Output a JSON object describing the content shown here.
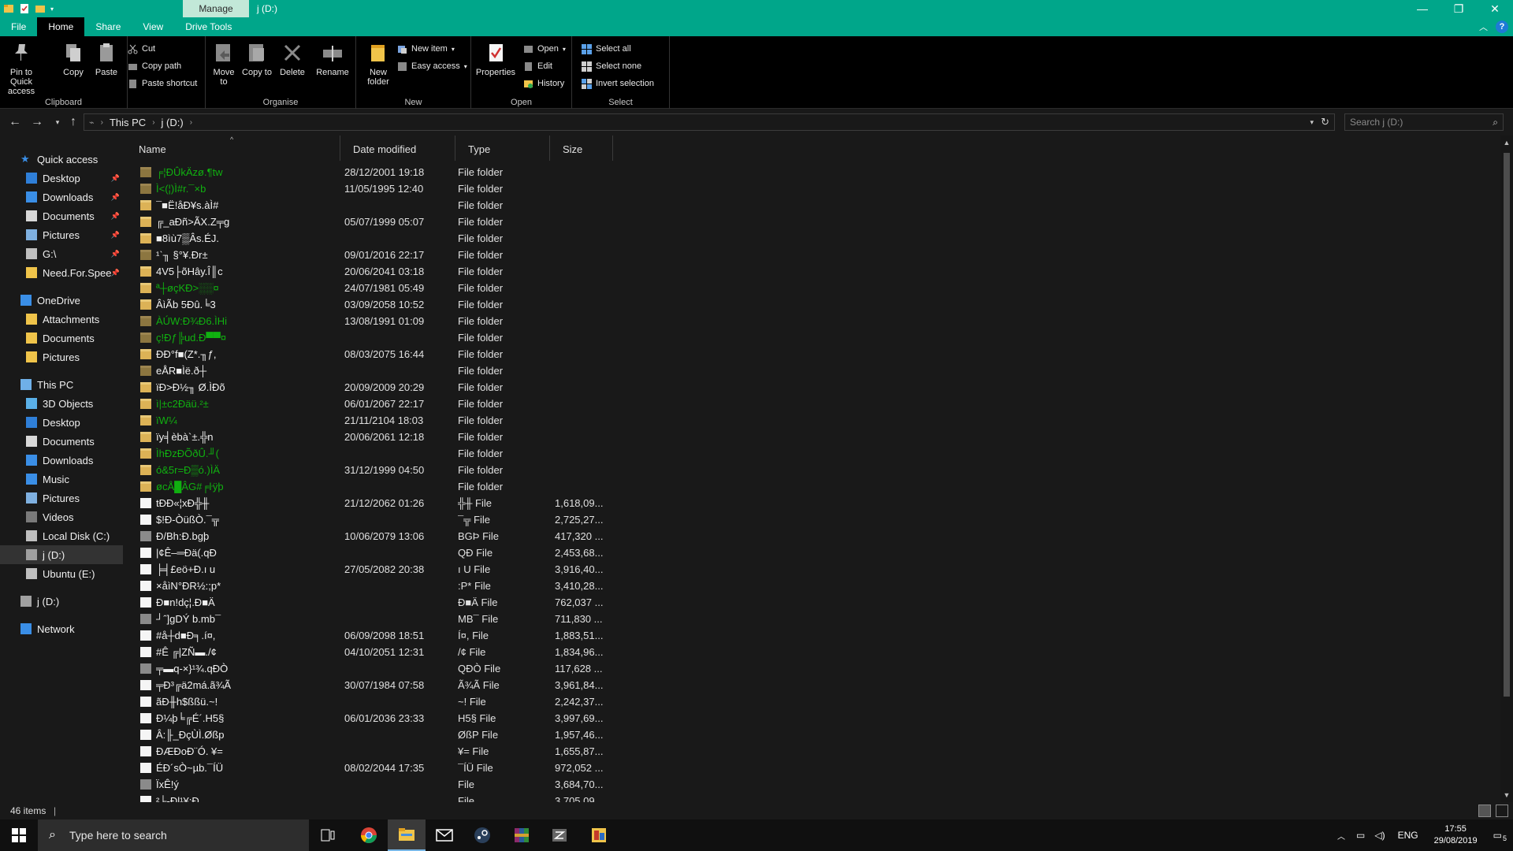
{
  "titlebar": {
    "context_tab": "Manage",
    "title": "j (D:)",
    "controls": [
      "—",
      "❐",
      "✕"
    ]
  },
  "tabs": [
    {
      "label": "File"
    },
    {
      "label": "Home"
    },
    {
      "label": "Share"
    },
    {
      "label": "View"
    },
    {
      "label": "Drive Tools"
    }
  ],
  "ribbon": {
    "clipboard": {
      "pin": "Pin to Quick access",
      "copy": "Copy",
      "paste": "Paste",
      "cut": "Cut",
      "copy_path": "Copy path",
      "paste_shortcut": "Paste shortcut",
      "label": "Clipboard"
    },
    "organise": {
      "move_to": "Move to",
      "copy_to": "Copy to",
      "delete": "Delete",
      "rename": "Rename",
      "label": "Organise"
    },
    "new": {
      "new_folder": "New folder",
      "new_item": "New item",
      "easy_access": "Easy access",
      "label": "New"
    },
    "open": {
      "properties": "Properties",
      "open": "Open",
      "edit": "Edit",
      "history": "History",
      "label": "Open"
    },
    "select": {
      "select_all": "Select all",
      "select_none": "Select none",
      "invert": "Invert selection",
      "label": "Select"
    }
  },
  "address": {
    "crumbs": [
      "This PC",
      "j (D:)"
    ],
    "search_placeholder": "Search j (D:)"
  },
  "nav": [
    {
      "label": "Quick access",
      "icon": "star-icon",
      "level": 0,
      "pinned": false
    },
    {
      "label": "Desktop",
      "icon": "desktop-icon",
      "level": 1,
      "pinned": true
    },
    {
      "label": "Downloads",
      "icon": "download-icon",
      "level": 1,
      "pinned": true
    },
    {
      "label": "Documents",
      "icon": "documents-icon",
      "level": 1,
      "pinned": true
    },
    {
      "label": "Pictures",
      "icon": "pictures-icon",
      "level": 1,
      "pinned": true
    },
    {
      "label": "G:\\",
      "icon": "network-drive-icon",
      "level": 1,
      "pinned": true
    },
    {
      "label": "Need.For.Spee",
      "icon": "folder-icon",
      "level": 1,
      "pinned": true
    },
    {
      "label": "OneDrive",
      "icon": "cloud-icon",
      "level": 0,
      "pinned": false
    },
    {
      "label": "Attachments",
      "icon": "folder-icon",
      "level": 1,
      "pinned": false
    },
    {
      "label": "Documents",
      "icon": "folder-icon",
      "level": 1,
      "pinned": false
    },
    {
      "label": "Pictures",
      "icon": "folder-icon",
      "level": 1,
      "pinned": false
    },
    {
      "label": "This PC",
      "icon": "pc-icon",
      "level": 0,
      "pinned": false
    },
    {
      "label": "3D Objects",
      "icon": "3d-objects-icon",
      "level": 1,
      "pinned": false
    },
    {
      "label": "Desktop",
      "icon": "desktop-icon",
      "level": 1,
      "pinned": false
    },
    {
      "label": "Documents",
      "icon": "documents-icon",
      "level": 1,
      "pinned": false
    },
    {
      "label": "Downloads",
      "icon": "download-icon",
      "level": 1,
      "pinned": false
    },
    {
      "label": "Music",
      "icon": "music-icon",
      "level": 1,
      "pinned": false
    },
    {
      "label": "Pictures",
      "icon": "pictures-icon",
      "level": 1,
      "pinned": false
    },
    {
      "label": "Videos",
      "icon": "videos-icon",
      "level": 1,
      "pinned": false
    },
    {
      "label": "Local Disk (C:)",
      "icon": "disk-icon",
      "level": 1,
      "pinned": false
    },
    {
      "label": "j (D:)",
      "icon": "usb-drive-icon",
      "level": 1,
      "pinned": false,
      "selected": true
    },
    {
      "label": "Ubuntu (E:)",
      "icon": "disk-icon",
      "level": 1,
      "pinned": false
    },
    {
      "label": "j (D:)",
      "icon": "usb-drive-icon",
      "level": 0,
      "pinned": false
    },
    {
      "label": "Network",
      "icon": "network-icon",
      "level": 0,
      "pinned": false
    }
  ],
  "columns": {
    "name": "Name",
    "date": "Date modified",
    "type": "Type",
    "size": "Size"
  },
  "files": [
    {
      "name": "╒¦ÐÛkÄzø.¶tw",
      "date": "28/12/2001 19:18",
      "type": "File folder",
      "size": "",
      "kind": "folder",
      "color": "green",
      "hidden": true
    },
    {
      "name": "Ì<(¦)Ì#r.¯×b",
      "date": "11/05/1995 12:40",
      "type": "File folder",
      "size": "",
      "kind": "folder",
      "color": "green",
      "hidden": true
    },
    {
      "name": "¯■Ë!åÐ¥s.àÌ#",
      "date": "",
      "type": "File folder",
      "size": "",
      "kind": "folder",
      "color": "white",
      "hidden": false
    },
    {
      "name": "╔_aÐñ>ÃX.Z╤g",
      "date": "05/07/1999 05:07",
      "type": "File folder",
      "size": "",
      "kind": "folder",
      "color": "white",
      "hidden": false
    },
    {
      "name": "■8ìù7▒Âs.ÉJ.",
      "date": "",
      "type": "File folder",
      "size": "",
      "kind": "folder",
      "color": "white",
      "hidden": false
    },
    {
      "name": "¹ˋ╖ §°¥.Ðr±",
      "date": "09/01/2016 22:17",
      "type": "File folder",
      "size": "",
      "kind": "folder",
      "color": "white",
      "hidden": true
    },
    {
      "name": "4V5├õHây.Î║c",
      "date": "20/06/2041 03:18",
      "type": "File folder",
      "size": "",
      "kind": "folder",
      "color": "white",
      "hidden": false
    },
    {
      "name": "ª┼øçKÐ>░░¤",
      "date": "24/07/1981 05:49",
      "type": "File folder",
      "size": "",
      "kind": "folder",
      "color": "green",
      "hidden": false
    },
    {
      "name": "ÂìÃb 5Ðû.╘3",
      "date": "03/09/2058 10:52",
      "type": "File folder",
      "size": "",
      "kind": "folder",
      "color": "white",
      "hidden": false
    },
    {
      "name": "ÀÚW:Ð¾Ð6.ÌHi",
      "date": "13/08/1991 01:09",
      "type": "File folder",
      "size": "",
      "kind": "folder",
      "color": "green",
      "hidden": true
    },
    {
      "name": "ç!Ðƒ╠ud.Ð▀▀¤",
      "date": "",
      "type": "File folder",
      "size": "",
      "kind": "folder",
      "color": "green",
      "hidden": true
    },
    {
      "name": "ÐÐ°f■(Z*.╖ƒ,",
      "date": "08/03/2075 16:44",
      "type": "File folder",
      "size": "",
      "kind": "folder",
      "color": "white",
      "hidden": false
    },
    {
      "name": "eÅR■Ìë.ð┼",
      "date": "",
      "type": "File folder",
      "size": "",
      "kind": "folder",
      "color": "white",
      "hidden": true
    },
    {
      "name": "ïÐ>Ð½╖ Ø.ÌÐõ",
      "date": "20/09/2009 20:29",
      "type": "File folder",
      "size": "",
      "kind": "folder",
      "color": "white",
      "hidden": false
    },
    {
      "name": "ì|±c2Ðäü.²±",
      "date": "06/01/2067 22:17",
      "type": "File folder",
      "size": "",
      "kind": "folder",
      "color": "green",
      "hidden": false
    },
    {
      "name": "ïW¼",
      "date": "21/11/2104 18:03",
      "type": "File folder",
      "size": "",
      "kind": "folder",
      "color": "green",
      "hidden": false
    },
    {
      "name": "ïy╡èbà`±.╬n",
      "date": "20/06/2061 12:18",
      "type": "File folder",
      "size": "",
      "kind": "folder",
      "color": "white",
      "hidden": false
    },
    {
      "name": "ÌhÐzÐÕðÛ.╜(",
      "date": "",
      "type": "File folder",
      "size": "",
      "kind": "folder",
      "color": "green",
      "hidden": false
    },
    {
      "name": "ó&5r=Ð▒ó.)ÌÄ",
      "date": "31/12/1999 04:50",
      "type": "File folder",
      "size": "",
      "kind": "folder",
      "color": "green",
      "hidden": false
    },
    {
      "name": "øcÅ█ÂG#╒ŀÿþ",
      "date": "",
      "type": "File folder",
      "size": "",
      "kind": "folder",
      "color": "green",
      "hidden": false
    },
    {
      "name": "tÐÐ«¦xÐ╬╫",
      "date": "21/12/2062 01:26",
      "type": "╬╫ File",
      "size": "1,618,09...",
      "kind": "file",
      "color": "white",
      "hidden": false
    },
    {
      "name": "$!Ð-ÒüßÒ.¯╦",
      "date": "",
      "type": "¯╦ File",
      "size": "2,725,27...",
      "kind": "file",
      "color": "white",
      "hidden": false
    },
    {
      "name": "Ð/Bh:Ð.bgþ",
      "date": "10/06/2079 13:06",
      "type": "BGÞ File",
      "size": "417,320 ...",
      "kind": "file",
      "color": "white",
      "hidden": true
    },
    {
      "name": "|¢Ê–═Ðä(.qÐ",
      "date": "",
      "type": "QÐ File",
      "size": "2,453,68...",
      "kind": "file",
      "color": "white",
      "hidden": false
    },
    {
      "name": "╞╡£eö+Ð.ı u",
      "date": "27/05/2082 20:38",
      "type": "ı U File",
      "size": "3,916,40...",
      "kind": "file",
      "color": "white",
      "hidden": false
    },
    {
      "name": "×åìN°ÐR½:;p*",
      "date": "",
      "type": ":P* File",
      "size": "3,410,28...",
      "kind": "file",
      "color": "white",
      "hidden": false
    },
    {
      "name": "Ð■n!dç¦.Ð■Ä",
      "date": "",
      "type": "Ð■Ä File",
      "size": "762,037 ...",
      "kind": "file",
      "color": "white",
      "hidden": false
    },
    {
      "name": "┘ˆ]gDÝ b.mb¯",
      "date": "",
      "type": "MB¯ File",
      "size": "711,830 ...",
      "kind": "file",
      "color": "white",
      "hidden": true
    },
    {
      "name": "#å┼d■Ð╕.í¤,",
      "date": "06/09/2098 18:51",
      "type": "Í¤, File",
      "size": "1,883,51...",
      "kind": "file",
      "color": "white",
      "hidden": false
    },
    {
      "name": "#Ê ╔|ZÑ▬./¢",
      "date": "04/10/2051 12:31",
      "type": "/¢ File",
      "size": "1,834,96...",
      "kind": "file",
      "color": "white",
      "hidden": false
    },
    {
      "name": "╤▬q-×}¹¾.qÐÒ",
      "date": "",
      "type": "QÐÒ File",
      "size": "117,628 ...",
      "kind": "file",
      "color": "white",
      "hidden": true
    },
    {
      "name": "╤Ð³╔ä2má.ã¾Ã",
      "date": "30/07/1984 07:58",
      "type": "Ã¾Ã File",
      "size": "3,961,84...",
      "kind": "file",
      "color": "white",
      "hidden": false
    },
    {
      "name": "ãÐ╫h$ßßü.~!",
      "date": "",
      "type": "~! File",
      "size": "2,242,37...",
      "kind": "file",
      "color": "white",
      "hidden": false
    },
    {
      "name": "Ð¼þ╘╔É´.H5§",
      "date": "06/01/2036 23:33",
      "type": "H5§ File",
      "size": "3,997,69...",
      "kind": "file",
      "color": "white",
      "hidden": false
    },
    {
      "name": "Â:╟_ÐçÙÌ.Øßp",
      "date": "",
      "type": "ØßP File",
      "size": "1,957,46...",
      "kind": "file",
      "color": "white",
      "hidden": false
    },
    {
      "name": "ÐÆÐoÐ¨Ó. ¥=",
      "date": "",
      "type": "¥= File",
      "size": "1,655,87...",
      "kind": "file",
      "color": "white",
      "hidden": false
    },
    {
      "name": "ÉÐ´sÒ~µb.¯ÍÜ",
      "date": "08/02/2044 17:35",
      "type": "¯ÍÜ File",
      "size": "972,052 ...",
      "kind": "file",
      "color": "white",
      "hidden": false
    },
    {
      "name": "ÏxÊ!ý",
      "date": "",
      "type": "File",
      "size": "3,684,70...",
      "kind": "file",
      "color": "white",
      "hidden": true
    },
    {
      "name": "²├-Ðl¹¥:Ð",
      "date": "",
      "type": "File",
      "size": "3,705,09...",
      "kind": "file",
      "color": "white",
      "hidden": false
    }
  ],
  "status": {
    "items": "46 items"
  },
  "taskbar": {
    "search_placeholder": "Type here to search",
    "apps": [
      "task-view-icon",
      "chrome-icon",
      "file-explorer-icon",
      "mail-icon",
      "steam-icon",
      "winrar-icon",
      "zip-icon",
      "app-icon"
    ],
    "lang": "ENG",
    "time": "17:55",
    "date": "29/08/2019",
    "notifications": "5"
  },
  "colors": {
    "accent": "#00a68a",
    "hidden_green": "#10b010"
  }
}
